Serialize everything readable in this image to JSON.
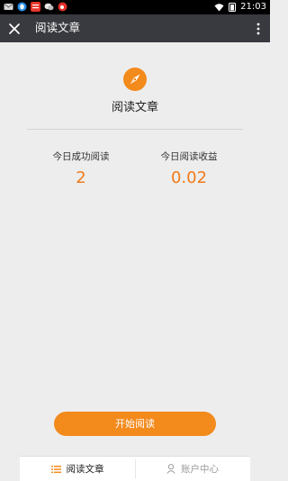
{
  "status_bar": {
    "time": "21:03",
    "icons": [
      "mail-icon",
      "qq-icon",
      "news-icon",
      "wechat-icon",
      "weibo-icon"
    ],
    "system_icons": [
      "wifi-icon",
      "battery-icon"
    ]
  },
  "app_bar": {
    "title": "阅读文章",
    "close_icon": "close-icon",
    "more_icon": "more-vertical-icon"
  },
  "main": {
    "logo_icon": "compass-icon",
    "section_title": "阅读文章",
    "stats": [
      {
        "label": "今日成功阅读",
        "value": "2"
      },
      {
        "label": "今日阅读收益",
        "value": "0.02"
      }
    ],
    "start_button": "开始阅读"
  },
  "tab_bar": {
    "tabs": [
      {
        "label": "阅读文章",
        "icon": "list-icon",
        "active": true
      },
      {
        "label": "账户中心",
        "icon": "user-icon",
        "active": false
      }
    ]
  },
  "colors": {
    "accent": "#f38a1c",
    "value_text": "#f07a1a",
    "app_bar": "#393a3f",
    "background": "#ededed",
    "active_tab_text": "#222222",
    "inactive_tab_text": "#9a9a9a"
  }
}
